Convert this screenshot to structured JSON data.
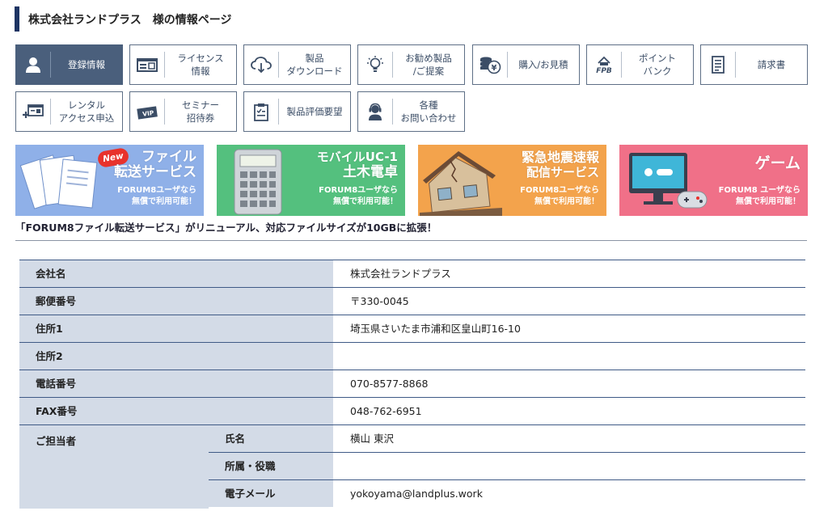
{
  "page_title": "株式会社ランドプラス　様の情報ページ",
  "menu": [
    {
      "label": "登録情報",
      "icon": "user-icon",
      "active": true
    },
    {
      "label": "ライセンス\n情報",
      "icon": "license-card-icon"
    },
    {
      "label": "製品\nダウンロード",
      "icon": "cloud-download-icon"
    },
    {
      "label": "お勧め製品\n/ご提案",
      "icon": "lightbulb-icon"
    },
    {
      "label": "購入/お見積",
      "icon": "coins-yen-icon"
    },
    {
      "label": "ポイント\nバンク",
      "icon": "fpb-point-icon"
    },
    {
      "label": "請求書",
      "icon": "invoice-icon"
    },
    {
      "label": "レンタル\nアクセス申込",
      "icon": "rental-access-icon"
    },
    {
      "label": "セミナー\n招待券",
      "icon": "vip-ticket-icon"
    },
    {
      "label": "製品評価要望",
      "icon": "clipboard-icon"
    },
    {
      "label": "各種\nお問い合わせ",
      "icon": "support-agent-icon"
    }
  ],
  "banners": [
    {
      "title_line1": "ファイル",
      "title_line2": "転送サービス",
      "sub": "FORUM8ユーザなら\n無償で利用可能！",
      "badge": "New",
      "color": "#7ea2e0"
    },
    {
      "title_line1": "モバイルUC-1",
      "title_line2": "土木電卓",
      "sub": "FORUM8ユーザなら\n無償で利用可能！",
      "color": "#4cba78"
    },
    {
      "title_line1": "緊急地震速報",
      "title_line2": "配信サービス",
      "sub": "FORUM8ユーザなら\n無償で利用可能！",
      "color": "#f2a14a"
    },
    {
      "title_line1": "ゲーム",
      "title_line2": "",
      "sub": "FORUM8 ユーザなら\n無償で利用可能！",
      "color": "#ef6f85"
    }
  ],
  "notice": "「FORUM8ファイル転送サービス」がリニューアル、対応ファイルサイズが10GBに拡張！",
  "info": {
    "company": {
      "label": "会社名",
      "value": "株式会社ランドプラス"
    },
    "zip": {
      "label": "郵便番号",
      "value": "〒330-0045"
    },
    "address1": {
      "label": "住所1",
      "value": "埼玉県さいたま市浦和区皇山町16-10"
    },
    "address2": {
      "label": "住所2",
      "value": ""
    },
    "tel": {
      "label": "電話番号",
      "value": "070-8577-8868"
    },
    "fax": {
      "label": "FAX番号",
      "value": "048-762-6951"
    },
    "contact": {
      "label": "ご担当者",
      "name": {
        "label": "氏名",
        "value": "横山 東沢"
      },
      "dept": {
        "label": "所属・役職",
        "value": ""
      },
      "email": {
        "label": "電子メール",
        "value": "yokoyama@landplus.work"
      }
    }
  }
}
